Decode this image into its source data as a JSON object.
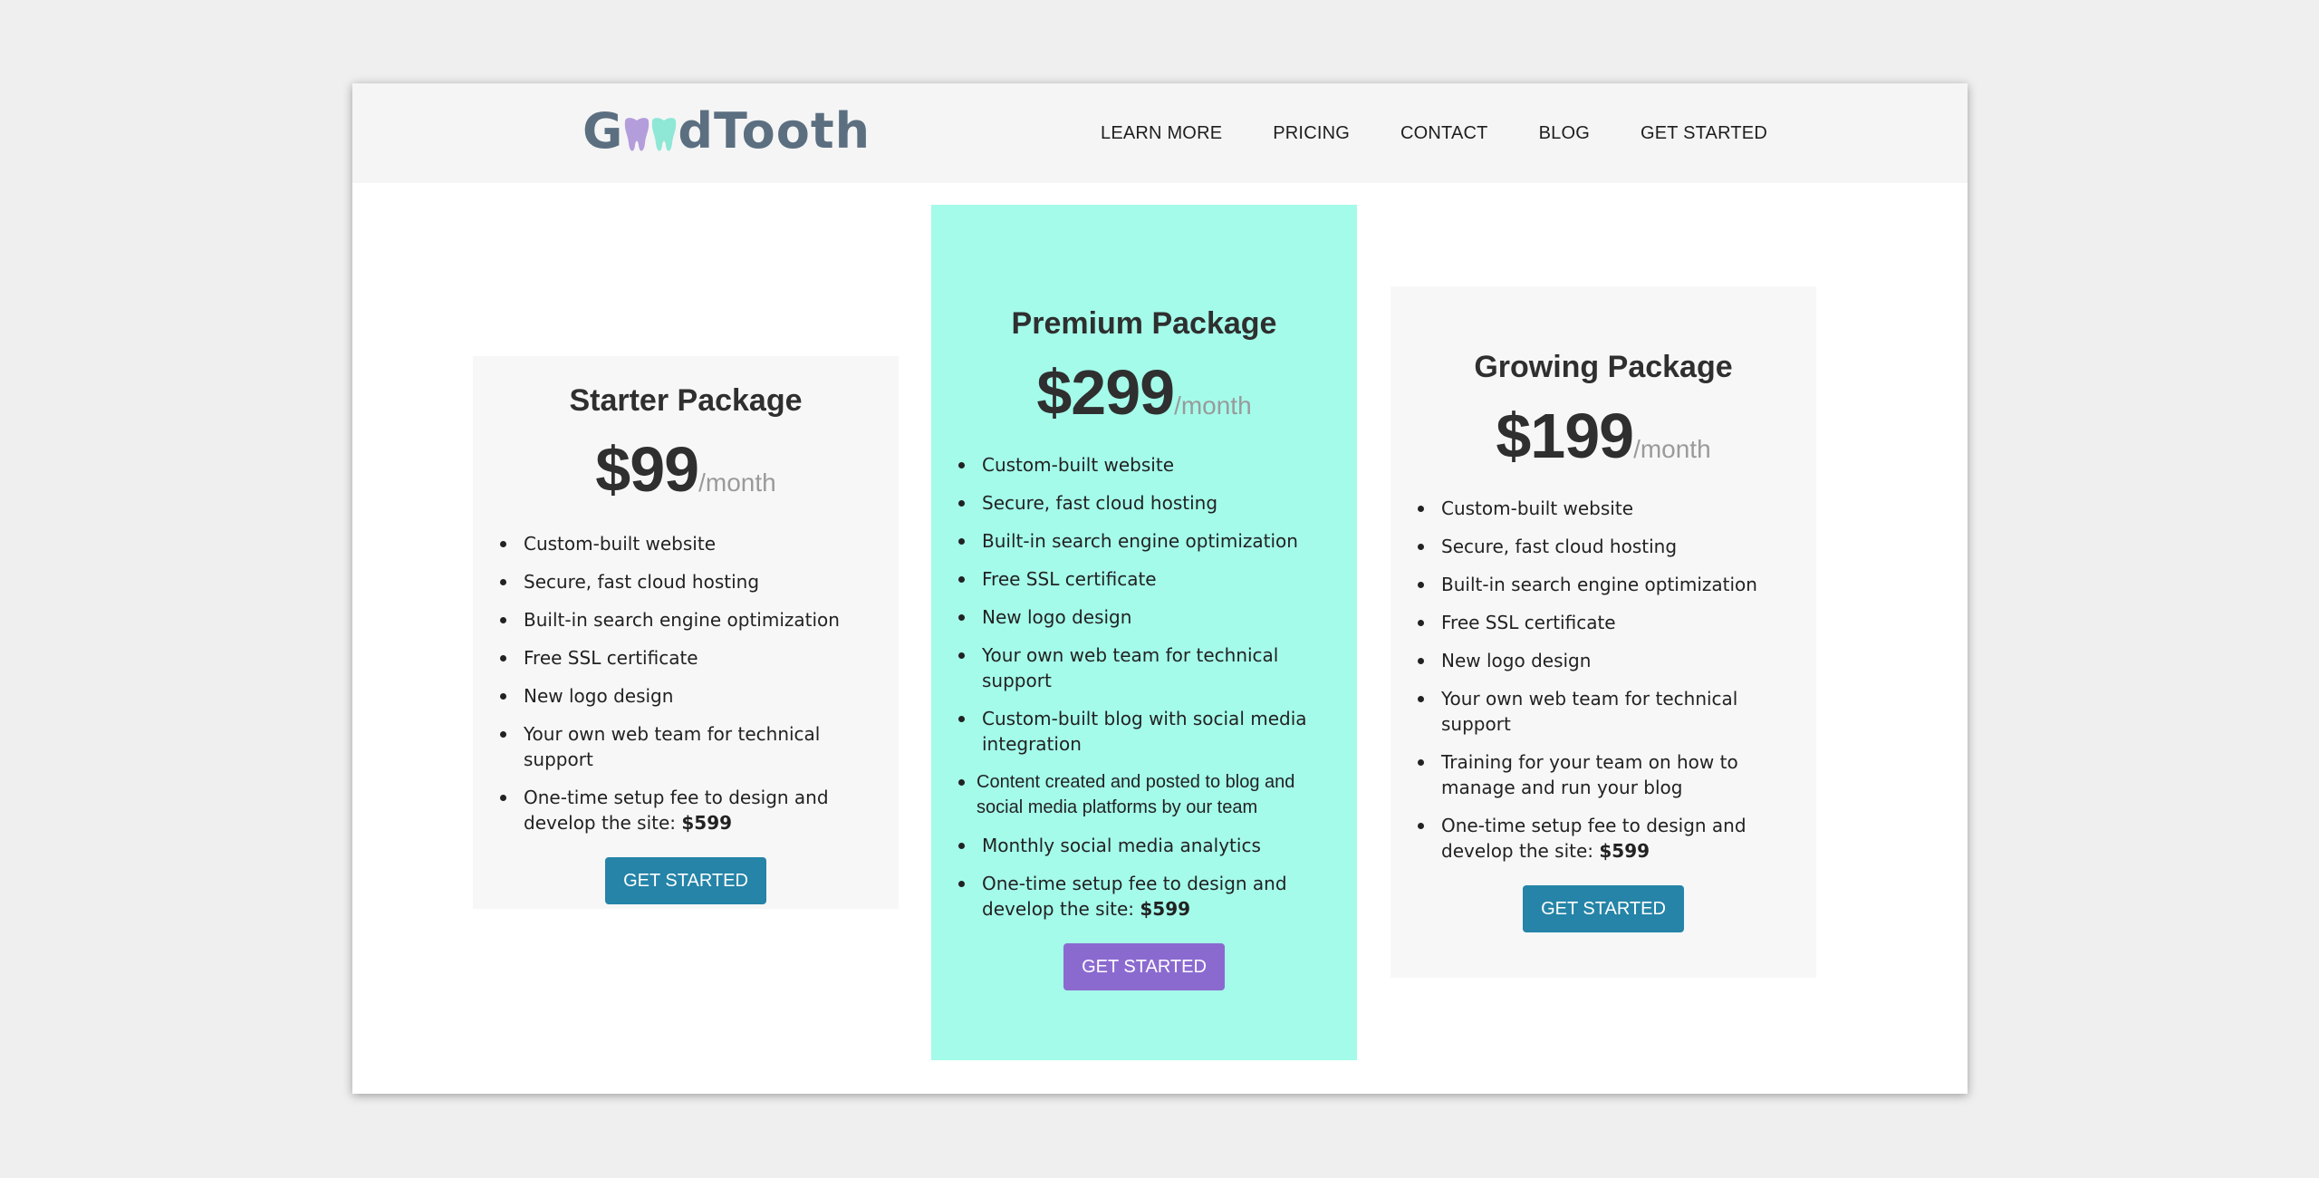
{
  "brand": {
    "name_prefix": "G",
    "name_suffix": "dTooth"
  },
  "nav": {
    "links": [
      "LEARN MORE",
      "PRICING",
      "CONTACT",
      "BLOG",
      "GET STARTED"
    ]
  },
  "colors": {
    "premium_bg": "#a4fbea",
    "card_bg": "#f7f7f7",
    "button_blue": "#2584a8",
    "button_purple": "#8b6ad0",
    "logo_text": "#5b6f80",
    "tooth_left": "#b39ddb",
    "tooth_right": "#8fe7d5"
  },
  "icons": {
    "logo_teeth": "tooth-icon"
  },
  "plans": {
    "starter": {
      "title": "Starter Package",
      "price": "$99",
      "per": "/month",
      "features": [
        "Custom-built website",
        "Secure, fast cloud hosting",
        "Built-in search engine optimization",
        "Free SSL certificate",
        "New logo design",
        "Your own web team for technical support"
      ],
      "setup_text": "One-time setup fee to design and develop the site: ",
      "setup_price": "$599",
      "button": "GET STARTED"
    },
    "premium": {
      "title": "Premium Package",
      "price": "$299",
      "per": "/month",
      "features": [
        "Custom-built website",
        "Secure, fast cloud hosting",
        "Built-in search engine optimization",
        "Free SSL certificate",
        "New logo design",
        "Your own web team for technical support",
        "Custom-built blog with social media integration"
      ],
      "content_feature": "Content created and posted to blog and social media platforms by our team",
      "analytics_feature": "Monthly social media analytics",
      "setup_text": "One-time setup fee to design and develop the site: ",
      "setup_price": "$599",
      "button": "GET STARTED"
    },
    "growing": {
      "title": "Growing Package",
      "price": "$199",
      "per": "/month",
      "features": [
        "Custom-built website",
        "Secure, fast cloud hosting",
        "Built-in search engine optimization",
        "Free SSL certificate",
        "New logo design",
        "Your own web team for technical support",
        "Training for your team on how to manage and run your blog"
      ],
      "setup_text": "One-time setup fee to design and develop the site: ",
      "setup_price": "$599",
      "button": "GET STARTED"
    }
  }
}
